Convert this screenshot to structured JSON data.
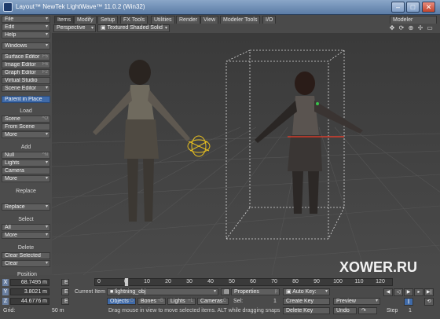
{
  "window": {
    "title": "Layout™ NewTek LightWave™ 11.0.2 (Win32)"
  },
  "menus": {
    "file": "File",
    "edit": "Edit",
    "help": "Help",
    "windows": "Windows",
    "editors": [
      {
        "label": "Surface Editor",
        "shortcut": "F5"
      },
      {
        "label": "Image Editor",
        "shortcut": "F6"
      },
      {
        "label": "Graph Editor",
        "shortcut": "F2"
      },
      {
        "label": "Virtual Studio",
        "shortcut": ""
      },
      {
        "label": "Scene Editor",
        "shortcut": ""
      }
    ],
    "parent_in_place": "Parent in Place",
    "load_header": "Load",
    "load": [
      {
        "label": "Scene",
        "shortcut": "^O"
      },
      {
        "label": "From Scene",
        "shortcut": ""
      },
      {
        "label": "More",
        "shortcut": ""
      }
    ],
    "add_header": "Add",
    "add": [
      {
        "label": "Null",
        "shortcut": "^N"
      },
      {
        "label": "Lights",
        "shortcut": ""
      },
      {
        "label": "Camera",
        "shortcut": ""
      },
      {
        "label": "More",
        "shortcut": ""
      }
    ],
    "replace_header": "Replace",
    "replace": "Replace",
    "select_header": "Select",
    "select": [
      {
        "label": "All",
        "shortcut": ""
      },
      {
        "label": "More",
        "shortcut": ""
      }
    ],
    "delete_header": "Delete",
    "delete": [
      {
        "label": "Clear Selected",
        "shortcut": ""
      },
      {
        "label": "Clear",
        "shortcut": ""
      }
    ]
  },
  "tabs": [
    "Items",
    "Modify",
    "Setup",
    "FX Tools",
    "Utilities",
    "Render",
    "View",
    "Modeler Tools",
    "I/O"
  ],
  "modeler_button": "Modeler",
  "viewport": {
    "view_mode": "Perspective",
    "render_mode": "Textured Shaded Solid",
    "watermark": "XOWER.RU"
  },
  "position": {
    "header": "Position",
    "x_label": "X",
    "x": "68.7495 m",
    "y_label": "Y",
    "y": "3.8021 m",
    "z_label": "Z",
    "z": "44.6776 m",
    "grid_label": "Grid:",
    "grid": "50 m"
  },
  "timeline": {
    "start": "0",
    "ticks": [
      "0",
      "10",
      "20",
      "30",
      "40",
      "50",
      "60",
      "70",
      "80",
      "90",
      "100",
      "110",
      "120"
    ]
  },
  "current_item": {
    "label": "Current Item",
    "value": "lightning_obj"
  },
  "item_buttons": [
    {
      "label": "Objects",
      "shortcut": "+O"
    },
    {
      "label": "Bones",
      "shortcut": "+B"
    },
    {
      "label": "Lights",
      "shortcut": "+L"
    },
    {
      "label": "Cameras",
      "shortcut": "+C"
    }
  ],
  "properties_label": "Properties",
  "sel_label": "Sel:",
  "sel_value": "1",
  "status_text": "Drag mouse in view to move selected items. ALT while dragging snaps",
  "keys": {
    "auto_key": "Auto Key:",
    "create_key": "Create Key",
    "delete_key": "Delete Key",
    "preview": "Preview",
    "undo": "Undo",
    "step_label": "Step",
    "step_value": "1"
  }
}
